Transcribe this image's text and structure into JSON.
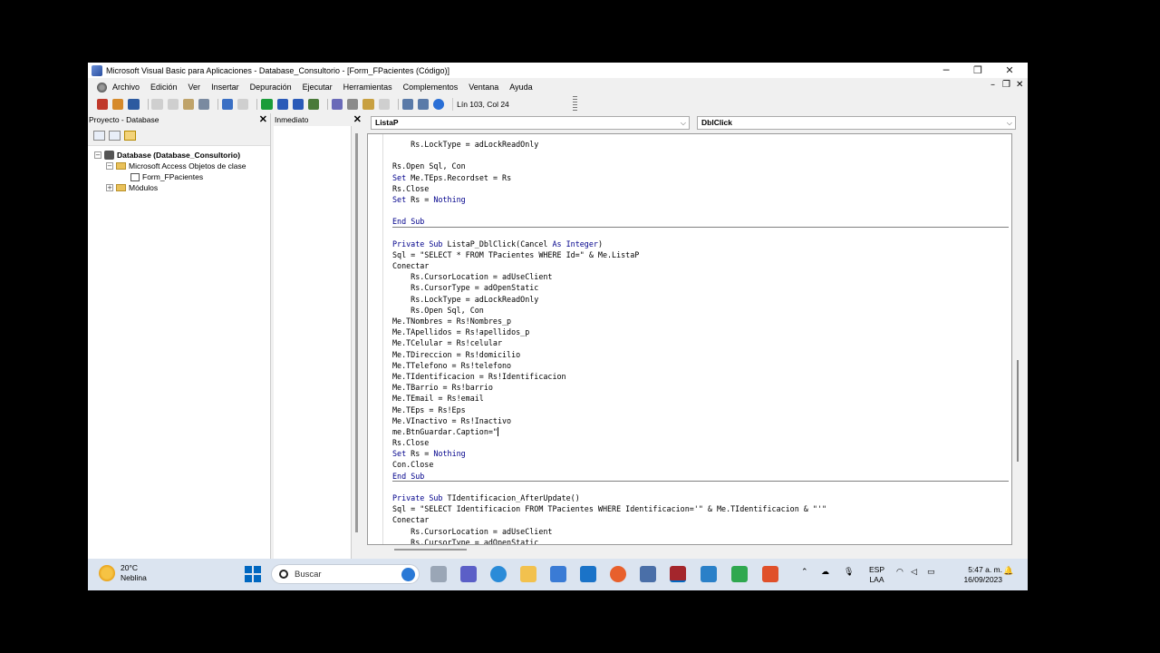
{
  "window": {
    "title": "Microsoft Visual Basic para Aplicaciones - Database_Consultorio - [Form_FPacientes (Código)]",
    "minimize": "─",
    "maximize": "❐",
    "close": "✕"
  },
  "menu": {
    "items": [
      "Archivo",
      "Edición",
      "Ver",
      "Insertar",
      "Depuración",
      "Ejecutar",
      "Herramientas",
      "Complementos",
      "Ventana",
      "Ayuda"
    ],
    "mdi_min": "–",
    "mdi_restore": "❐",
    "mdi_close": "✕"
  },
  "toolbar": {
    "position_text": "Lín 103, Col 24"
  },
  "project": {
    "title": "Proyecto - Database",
    "close": "✕",
    "tree": {
      "root": "Database (Database_Consultorio)",
      "folder1": "Microsoft Access Objetos de clase",
      "item1": "Form_FPacientes",
      "folder2": "Módulos"
    }
  },
  "immediate": {
    "title": "Inmediato",
    "close": "✕"
  },
  "code": {
    "object_combo": "ListaP",
    "proc_combo": "DblClick",
    "lines": [
      {
        "t": "    Rs.LockType = adLockReadOnly",
        "sep": false
      },
      {
        "t": "",
        "sep": false
      },
      {
        "t": "Rs.Open Sql, Con",
        "sep": false
      },
      {
        "t": "Set Me.TEps.Recordset = Rs",
        "sep": false
      },
      {
        "t": "Rs.Close",
        "sep": false
      },
      {
        "t": "Set Rs = Nothing",
        "sep": false
      },
      {
        "t": "",
        "sep": false
      },
      {
        "t": "End Sub",
        "sep": true
      },
      {
        "t": "",
        "sep": false
      },
      {
        "t": "Private Sub ListaP_DblClick(Cancel As Integer)",
        "sep": false
      },
      {
        "t": "Sql = \"SELECT * FROM TPacientes WHERE Id=\" & Me.ListaP",
        "sep": false
      },
      {
        "t": "Conectar",
        "sep": false
      },
      {
        "t": "    Rs.CursorLocation = adUseClient",
        "sep": false
      },
      {
        "t": "    Rs.CursorType = adOpenStatic",
        "sep": false
      },
      {
        "t": "    Rs.LockType = adLockReadOnly",
        "sep": false
      },
      {
        "t": "    Rs.Open Sql, Con",
        "sep": false
      },
      {
        "t": "Me.TNombres = Rs!Nombres_p",
        "sep": false
      },
      {
        "t": "Me.TApellidos = Rs!apellidos_p",
        "sep": false
      },
      {
        "t": "Me.TCelular = Rs!celular",
        "sep": false
      },
      {
        "t": "Me.TDireccion = Rs!domicilio",
        "sep": false
      },
      {
        "t": "Me.TTelefono = Rs!telefono",
        "sep": false
      },
      {
        "t": "Me.TIdentificacion = Rs!Identificacion",
        "sep": false
      },
      {
        "t": "Me.TBarrio = Rs!barrio",
        "sep": false
      },
      {
        "t": "Me.TEmail = Rs!email",
        "sep": false
      },
      {
        "t": "Me.TEps = Rs!Eps",
        "sep": false
      },
      {
        "t": "Me.VInactivo = Rs!Inactivo",
        "sep": false
      },
      {
        "t": "me.BtnGuardar.Caption=\"",
        "sep": false,
        "cursor": true
      },
      {
        "t": "Rs.Close",
        "sep": false
      },
      {
        "t": "Set Rs = Nothing",
        "sep": false
      },
      {
        "t": "Con.Close",
        "sep": false
      },
      {
        "t": "End Sub",
        "sep": true
      },
      {
        "t": "",
        "sep": false
      },
      {
        "t": "Private Sub TIdentificacion_AfterUpdate()",
        "sep": false
      },
      {
        "t": "Sql = \"SELECT Identificacion FROM TPacientes WHERE Identificacion='\" & Me.TIdentificacion & \"'\"",
        "sep": false
      },
      {
        "t": "Conectar",
        "sep": false
      },
      {
        "t": "    Rs.CursorLocation = adUseClient",
        "sep": false
      },
      {
        "t": "    Rs.CursorType = adOpenStatic",
        "sep": false
      }
    ]
  },
  "taskbar": {
    "temperature": "20°C",
    "weather": "Neblina",
    "search_placeholder": "Buscar",
    "lang_top": "ESP",
    "lang_bottom": "LAA",
    "time": "5:47 a. m.",
    "date": "16/09/2023"
  },
  "colors": {
    "keyword": "#00008b",
    "taskbar_bg": "#dbe4f0",
    "windows_blue": "#0067c0"
  }
}
